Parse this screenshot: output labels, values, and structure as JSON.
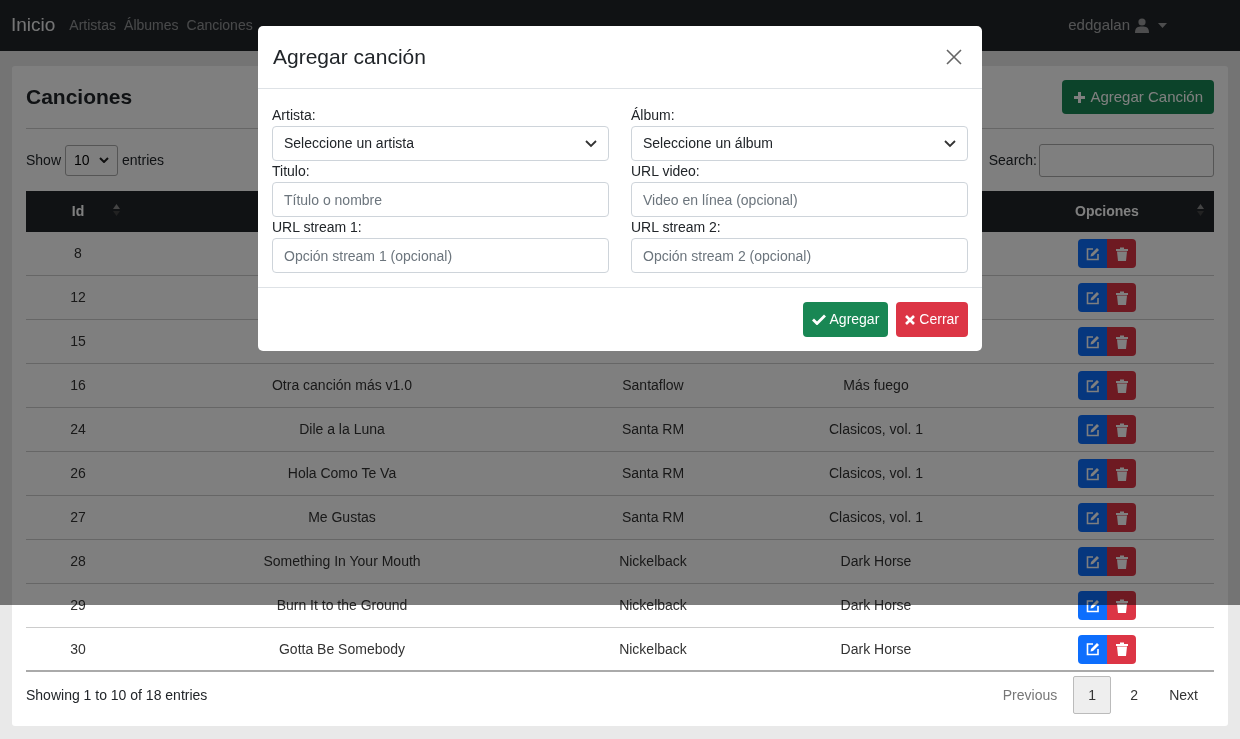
{
  "navbar": {
    "brand": "Inicio",
    "links": [
      {
        "label": "Artistas"
      },
      {
        "label": "Álbumes"
      },
      {
        "label": "Canciones"
      }
    ],
    "user": "eddgalan"
  },
  "page": {
    "title": "Canciones",
    "add_button": "Agregar Canción"
  },
  "length_control": {
    "show": "Show",
    "value": "10",
    "entries": "entries"
  },
  "search": {
    "label": "Search:"
  },
  "table": {
    "columns": {
      "id": "Id",
      "options": "Opciones"
    },
    "rows": [
      {
        "id": "8"
      },
      {
        "id": "12"
      },
      {
        "id": "15"
      },
      {
        "id": "16",
        "title": "Otra canción más v1.0",
        "artist": "Santaflow",
        "album": "Más fuego"
      },
      {
        "id": "24",
        "title": "Dile a la Luna",
        "artist": "Santa RM",
        "album": "Clasicos, vol. 1"
      },
      {
        "id": "26",
        "title": "Hola Como Te Va",
        "artist": "Santa RM",
        "album": "Clasicos, vol. 1"
      },
      {
        "id": "27",
        "title": "Me Gustas",
        "artist": "Santa RM",
        "album": "Clasicos, vol. 1"
      },
      {
        "id": "28",
        "title": "Something In Your Mouth",
        "artist": "Nickelback",
        "album": "Dark Horse"
      },
      {
        "id": "29",
        "title": "Burn It to the Ground",
        "artist": "Nickelback",
        "album": "Dark Horse"
      },
      {
        "id": "30",
        "title": "Gotta Be Somebody",
        "artist": "Nickelback",
        "album": "Dark Horse"
      }
    ]
  },
  "info": "Showing 1 to 10 of 18 entries",
  "pagination": {
    "previous": {
      "label": "Previous",
      "disabled": true
    },
    "pages": [
      {
        "label": "1",
        "selected": true
      },
      {
        "label": "2",
        "selected": false
      }
    ],
    "next": {
      "label": "Next",
      "disabled": false
    }
  },
  "modal": {
    "title": "Agregar canción",
    "fields": [
      {
        "kind": "select",
        "label": "Artista:",
        "value": "Seleccione un artista"
      },
      {
        "kind": "select",
        "label": "Álbum:",
        "value": "Seleccione un álbum"
      },
      {
        "kind": "text",
        "label": "Titulo:",
        "placeholder": "Título o nombre"
      },
      {
        "kind": "text",
        "label": "URL video:",
        "placeholder": "Video en línea (opcional)"
      },
      {
        "kind": "text",
        "label": "URL stream 1:",
        "placeholder": "Opción stream 1 (opcional)"
      },
      {
        "kind": "text",
        "label": "URL stream 2:",
        "placeholder": "Opción stream 2 (opcional)"
      }
    ],
    "buttons": [
      {
        "kind": "confirm",
        "label": "Agregar"
      },
      {
        "kind": "cancel",
        "label": "Cerrar"
      }
    ]
  }
}
